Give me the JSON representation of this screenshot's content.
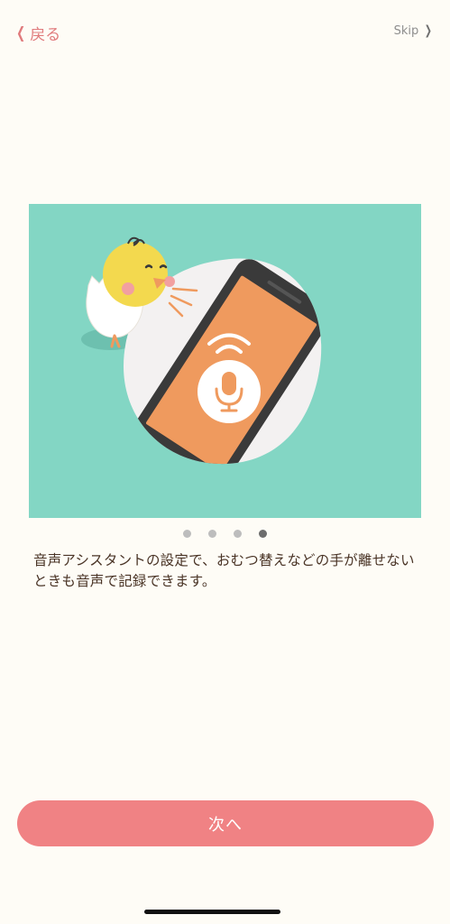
{
  "nav": {
    "back_label": "戻る",
    "skip_label": "Skip"
  },
  "icons": {
    "back": "chevron-left-icon",
    "skip": "chevron-right-icon",
    "illustration": "chick-voice-assistant-phone-illustration",
    "microphone": "microphone-icon"
  },
  "pager": {
    "total": 4,
    "active_index": 3
  },
  "description": "音声アシスタントの設定で、おむつ替えなどの手が離せないときも音声で記録できます。",
  "next_button_label": "次へ",
  "colors": {
    "background": "#FEFCF6",
    "accent": "#F08284",
    "back_text": "#E07B7D",
    "illustration_bg": "#83D6C4",
    "phone_screen": "#EF9A5E",
    "body_text": "#4A3426"
  }
}
